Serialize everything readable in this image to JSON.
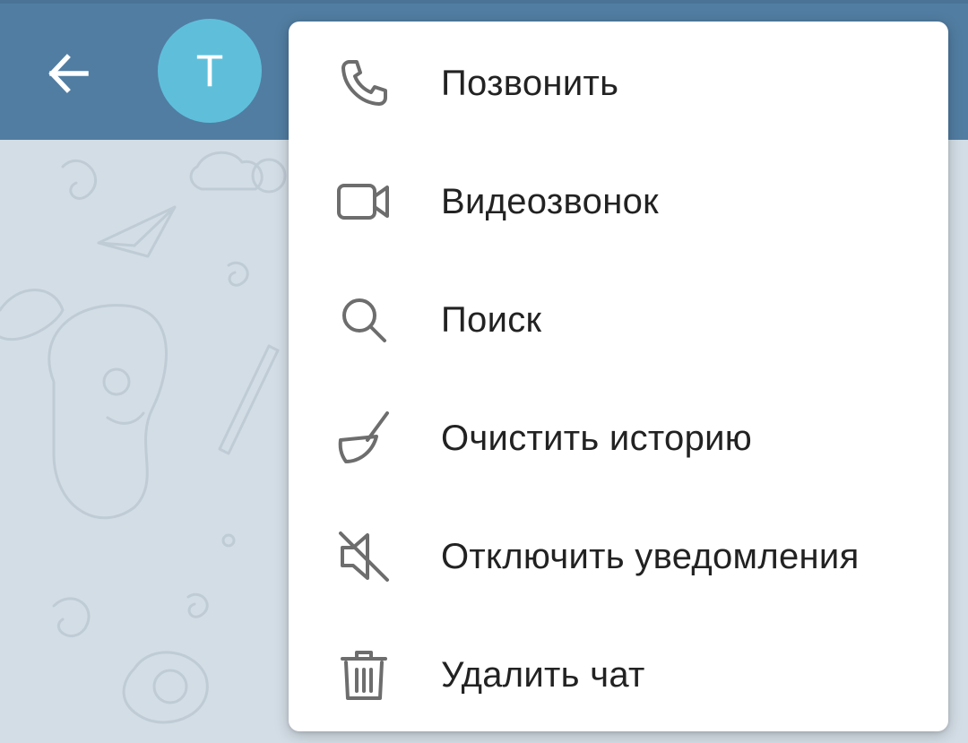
{
  "header": {
    "back_icon": "arrow-left-icon",
    "avatar_letter": "T",
    "colors": {
      "header_bg": "#517da2",
      "avatar_bg": "#5fbfdb"
    }
  },
  "menu": {
    "items": [
      {
        "label": "Позвонить",
        "icon": "phone-icon"
      },
      {
        "label": "Видеозвонок",
        "icon": "video-camera-icon"
      },
      {
        "label": "Поиск",
        "icon": "search-icon"
      },
      {
        "label": "Очистить историю",
        "icon": "broom-icon"
      },
      {
        "label": "Отключить уведомления",
        "icon": "mute-icon"
      },
      {
        "label": "Удалить чат",
        "icon": "trash-icon"
      }
    ]
  }
}
